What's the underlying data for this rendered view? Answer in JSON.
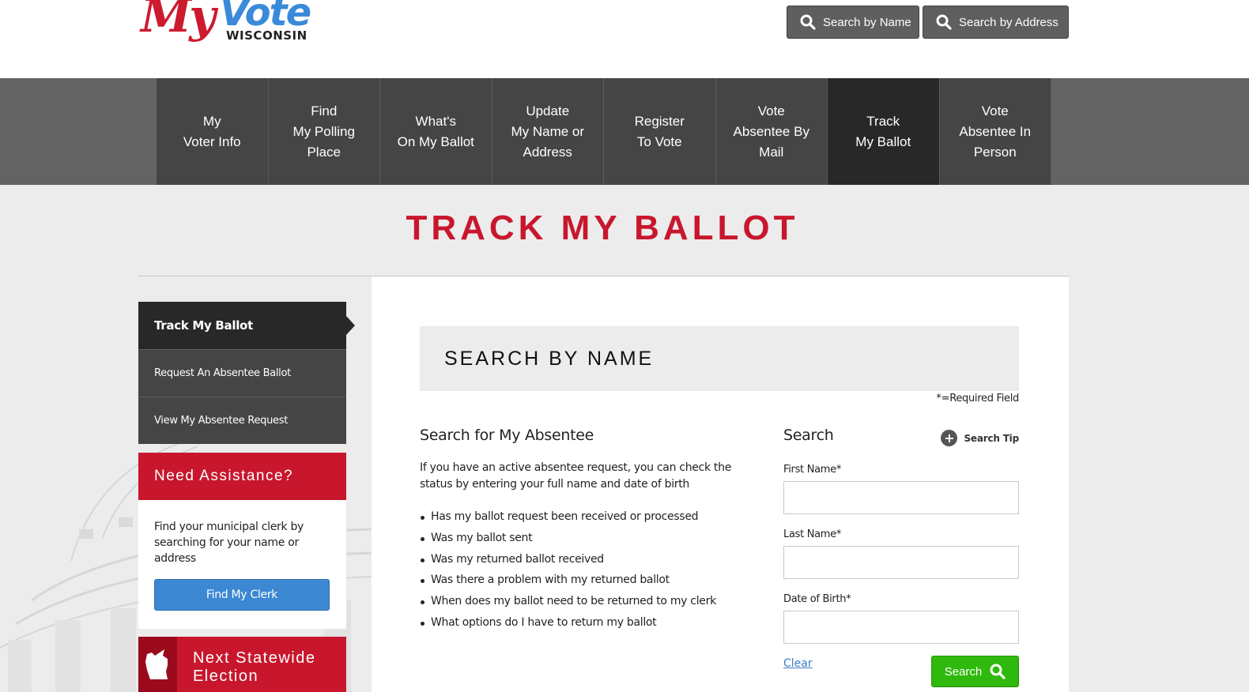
{
  "header": {
    "logo": {
      "script": "My",
      "accent": "Vote",
      "state": "WISCONSIN"
    },
    "buttons": [
      {
        "label": "Search by Name",
        "icon": "search-icon"
      },
      {
        "label": "Search by Address",
        "icon": "search-icon"
      }
    ]
  },
  "nav": {
    "items": [
      {
        "label": "My\nVoter Info",
        "active": false
      },
      {
        "label": "Find\nMy Polling\nPlace",
        "active": false
      },
      {
        "label": "What's\nOn My Ballot",
        "active": false
      },
      {
        "label": "Update\nMy Name or\nAddress",
        "active": false
      },
      {
        "label": "Register\nTo Vote",
        "active": false
      },
      {
        "label": "Vote\nAbsentee By\nMail",
        "active": false
      },
      {
        "label": "Track\nMy Ballot",
        "active": true
      },
      {
        "label": "Vote\nAbsentee In\nPerson",
        "active": false
      }
    ]
  },
  "page": {
    "title": "TRACK MY BALLOT"
  },
  "sidebar": {
    "items": [
      {
        "label": "Track My Ballot",
        "active": true
      },
      {
        "label": "Request An Absentee Ballot",
        "active": false
      },
      {
        "label": "View My Absentee Request",
        "active": false
      }
    ],
    "assistance": {
      "heading": "Need Assistance?",
      "text": "Find your municipal clerk by searching for your name or address",
      "button": "Find My Clerk"
    },
    "next_election": {
      "heading": "Next Statewide Election",
      "icon": "wisconsin-map-icon"
    }
  },
  "main": {
    "section_title": "SEARCH BY NAME",
    "required_note": "*=Required Field",
    "left": {
      "heading": "Search for My Absentee",
      "intro": "If you have an active absentee request, you can check the status by entering your full name and date of birth",
      "bullets": [
        "Has my ballot request been received or processed",
        "Was my ballot sent",
        "Was my returned ballot received",
        "Was there a problem with my returned ballot",
        "When does my ballot need to be returned to my clerk",
        "What options do I have to return my ballot"
      ]
    },
    "form": {
      "heading": "Search",
      "tip_label": "Search Tip",
      "fields": [
        {
          "label": "First Name*",
          "value": "",
          "placeholder": ""
        },
        {
          "label": "Last Name*",
          "value": "",
          "placeholder": ""
        },
        {
          "label": "Date of Birth*",
          "value": "",
          "placeholder": ""
        }
      ],
      "clear_label": "Clear",
      "submit_label": "Search"
    }
  },
  "colors": {
    "brand_red": "#c8172d",
    "brand_blue": "#3b8ad9",
    "nav_bg": "#454545",
    "nav_active": "#282828",
    "search_green": "#2fb90c",
    "clerk_blue": "#3c88d2"
  }
}
